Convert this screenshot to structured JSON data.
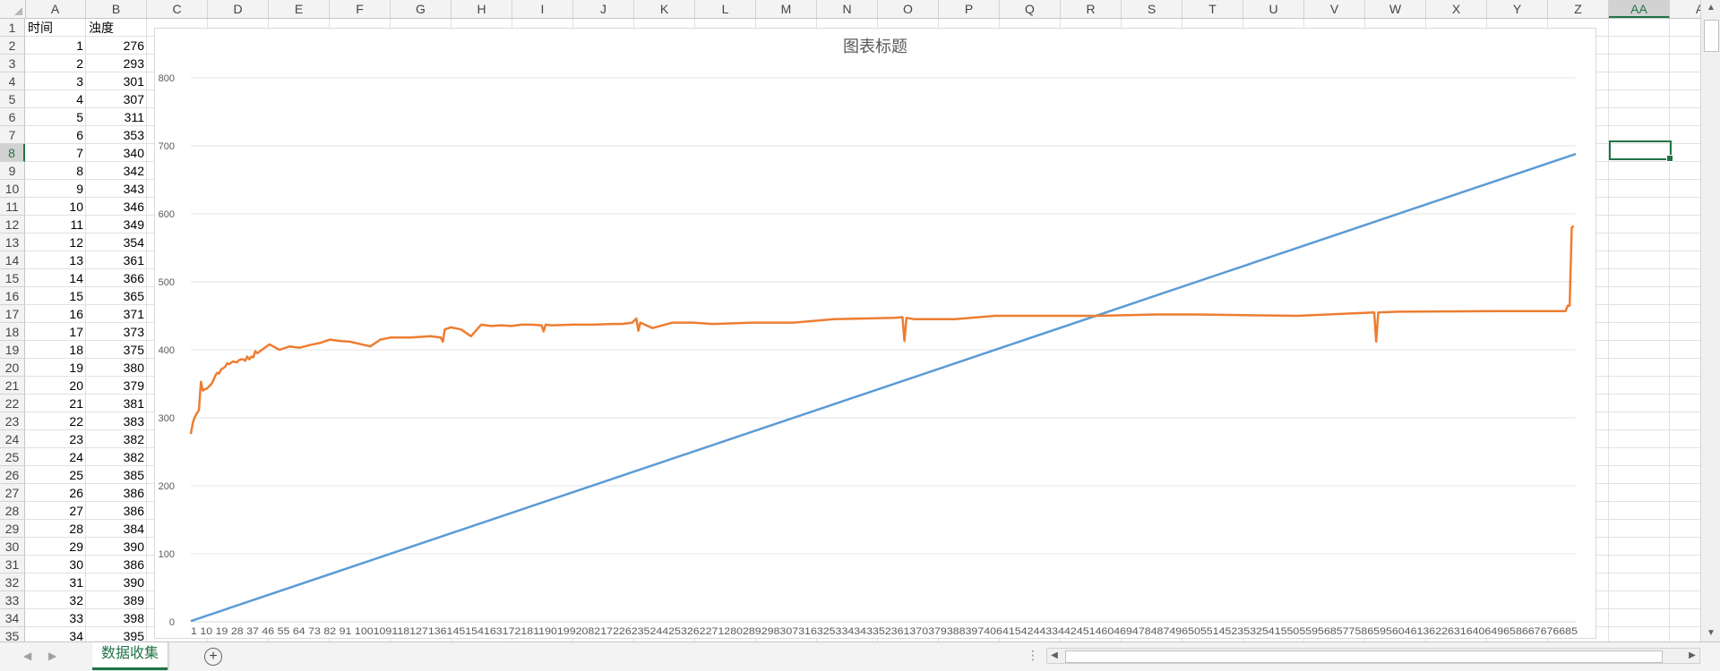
{
  "columns": [
    "A",
    "B",
    "C",
    "D",
    "E",
    "F",
    "G",
    "H",
    "I",
    "J",
    "K",
    "L",
    "M",
    "N",
    "O",
    "P",
    "Q",
    "R",
    "S",
    "T",
    "U",
    "V",
    "W",
    "X",
    "Y",
    "Z",
    "AA",
    "A"
  ],
  "active_column": "AA",
  "active_row": "8",
  "row_numbers": [
    "1",
    "2",
    "3",
    "4",
    "5",
    "6",
    "7",
    "8",
    "9",
    "10",
    "11",
    "12",
    "13",
    "14",
    "15",
    "16",
    "17",
    "18",
    "19",
    "20",
    "21",
    "22",
    "23",
    "24",
    "25",
    "26",
    "27",
    "28",
    "29",
    "30",
    "31",
    "32",
    "33",
    "34",
    "35"
  ],
  "table": {
    "header": [
      "时间",
      "浊度"
    ],
    "rows": [
      [
        "1",
        "276"
      ],
      [
        "2",
        "293"
      ],
      [
        "3",
        "301"
      ],
      [
        "4",
        "307"
      ],
      [
        "5",
        "311"
      ],
      [
        "6",
        "353"
      ],
      [
        "7",
        "340"
      ],
      [
        "8",
        "342"
      ],
      [
        "9",
        "343"
      ],
      [
        "10",
        "346"
      ],
      [
        "11",
        "349"
      ],
      [
        "12",
        "354"
      ],
      [
        "13",
        "361"
      ],
      [
        "14",
        "366"
      ],
      [
        "15",
        "365"
      ],
      [
        "16",
        "371"
      ],
      [
        "17",
        "373"
      ],
      [
        "18",
        "375"
      ],
      [
        "19",
        "380"
      ],
      [
        "20",
        "379"
      ],
      [
        "21",
        "381"
      ],
      [
        "22",
        "383"
      ],
      [
        "23",
        "382"
      ],
      [
        "24",
        "382"
      ],
      [
        "25",
        "385"
      ],
      [
        "26",
        "386"
      ],
      [
        "27",
        "386"
      ],
      [
        "28",
        "384"
      ],
      [
        "29",
        "390"
      ],
      [
        "30",
        "386"
      ],
      [
        "31",
        "390"
      ],
      [
        "32",
        "389"
      ],
      [
        "33",
        "398"
      ],
      [
        "34",
        "395"
      ]
    ]
  },
  "sheet_tab": "数据收集",
  "add_sheet_icon": "plus-circle-icon",
  "colors": {
    "series_time": "#5b9bd5",
    "series_turbidity": "#ed7d31",
    "excel_green": "#217346"
  },
  "chart_data": {
    "type": "line",
    "title": "图表标题",
    "ylim": [
      0,
      800
    ],
    "yticks": [
      "0",
      "100",
      "200",
      "300",
      "400",
      "500",
      "600",
      "700",
      "800"
    ],
    "xlim": [
      1,
      688
    ],
    "x_tick_text": "1 10 19 28 37 46 55 64 73 82 91 100109118127136145154163172181190199208217226235244253262271280289298307316325334343352361370379388397406415424433442451460469478487496505514523532541550559568577586595604613622631640649658667676685",
    "legend": "none",
    "grid": "horizontal",
    "series": [
      {
        "color": "#5b9bd5",
        "x": [
          1,
          688
        ],
        "values": [
          1,
          688
        ]
      },
      {
        "color": "#ed7d31",
        "x": [
          1,
          2,
          3,
          4,
          5,
          6,
          7,
          8,
          9,
          10,
          11,
          12,
          13,
          14,
          15,
          16,
          17,
          18,
          19,
          20,
          21,
          22,
          23,
          24,
          25,
          26,
          27,
          28,
          29,
          30,
          31,
          32,
          33,
          34,
          40,
          45,
          50,
          55,
          60,
          65,
          70,
          75,
          80,
          90,
          95,
          100,
          110,
          120,
          125,
          126,
          127,
          130,
          135,
          140,
          145,
          150,
          155,
          160,
          165,
          170,
          175,
          176,
          177,
          180,
          190,
          200,
          210,
          215,
          220,
          222,
          223,
          224,
          230,
          240,
          250,
          260,
          280,
          300,
          320,
          350,
          354,
          355,
          356,
          360,
          380,
          400,
          420,
          450,
          480,
          500,
          550,
          580,
          588,
          589,
          590,
          600,
          650,
          683,
          684,
          685,
          686,
          687
        ],
        "values": [
          276,
          293,
          301,
          307,
          311,
          353,
          340,
          342,
          343,
          346,
          349,
          354,
          361,
          366,
          365,
          371,
          373,
          375,
          380,
          379,
          381,
          383,
          382,
          382,
          385,
          386,
          386,
          384,
          390,
          386,
          390,
          389,
          398,
          395,
          408,
          400,
          405,
          403,
          407,
          410,
          415,
          413,
          412,
          405,
          415,
          418,
          418,
          420,
          418,
          412,
          430,
          433,
          430,
          420,
          437,
          435,
          436,
          435,
          437,
          437,
          436,
          427,
          437,
          436,
          437,
          437,
          438,
          438,
          440,
          446,
          428,
          440,
          432,
          440,
          440,
          438,
          440,
          440,
          445,
          447,
          448,
          413,
          447,
          445,
          445,
          450,
          450,
          450,
          452,
          452,
          450,
          454,
          455,
          412,
          455,
          456,
          457,
          457,
          465,
          465,
          580,
          582
        ]
      }
    ]
  }
}
